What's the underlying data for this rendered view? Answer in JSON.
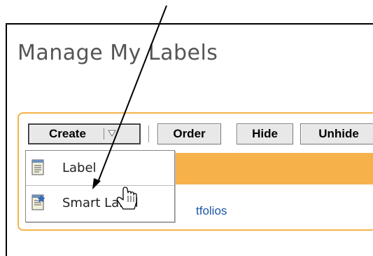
{
  "page": {
    "title": "Manage My Labels"
  },
  "toolbar": {
    "create_label": "Create",
    "order_label": "Order",
    "hide_label": "Hide",
    "unhide_label": "Unhide"
  },
  "create_menu": {
    "items": [
      {
        "label": "Label",
        "icon": "label-document-icon"
      },
      {
        "label": "Smart Label",
        "icon": "smart-label-document-icon"
      }
    ]
  },
  "content": {
    "link_fragment": "tfolios"
  },
  "colors": {
    "accent_orange": "#f7b14a",
    "toolbar_border": "#f3b34a",
    "link_blue": "#1d56a8"
  }
}
